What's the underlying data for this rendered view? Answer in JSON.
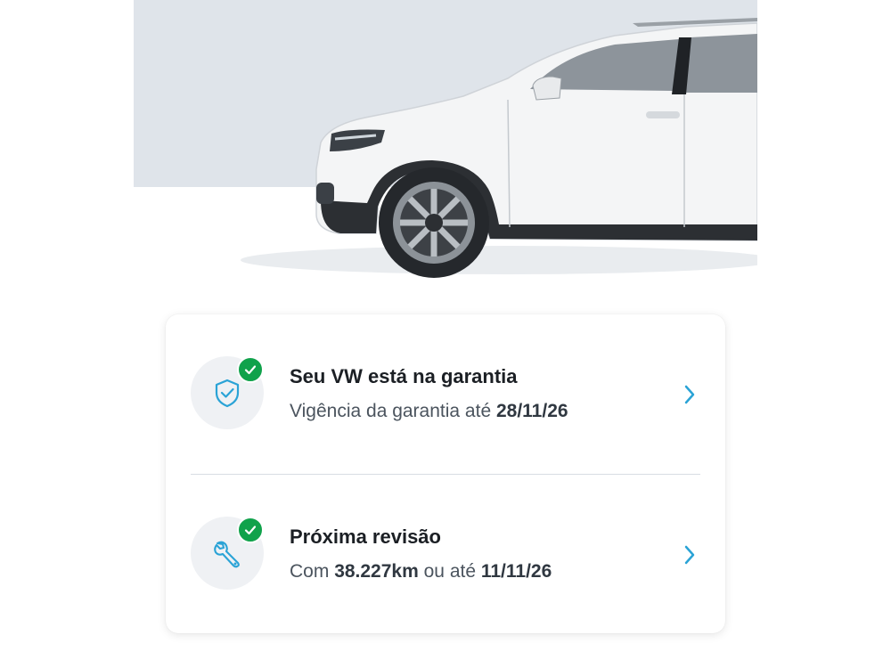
{
  "colors": {
    "accent": "#2aa3d6",
    "success_badge": "#10a24b",
    "hero_background": "#dfe4ea",
    "card_background": "#ffffff"
  },
  "hero": {
    "image": "white-vw-suv-side-view"
  },
  "status_card": {
    "items": [
      {
        "icon": "shield-check-icon",
        "status_badge": "check-icon",
        "title": "Seu VW está na garantia",
        "subtitle_prefix": "Vigência da garantia até",
        "subtitle_date": "28/11/26"
      },
      {
        "icon": "wrench-icon",
        "status_badge": "check-icon",
        "title": "Próxima revisão",
        "subtitle_prefix": "Com",
        "subtitle_km": "38.227km",
        "subtitle_middle": "ou até",
        "subtitle_date": "11/11/26"
      }
    ]
  }
}
